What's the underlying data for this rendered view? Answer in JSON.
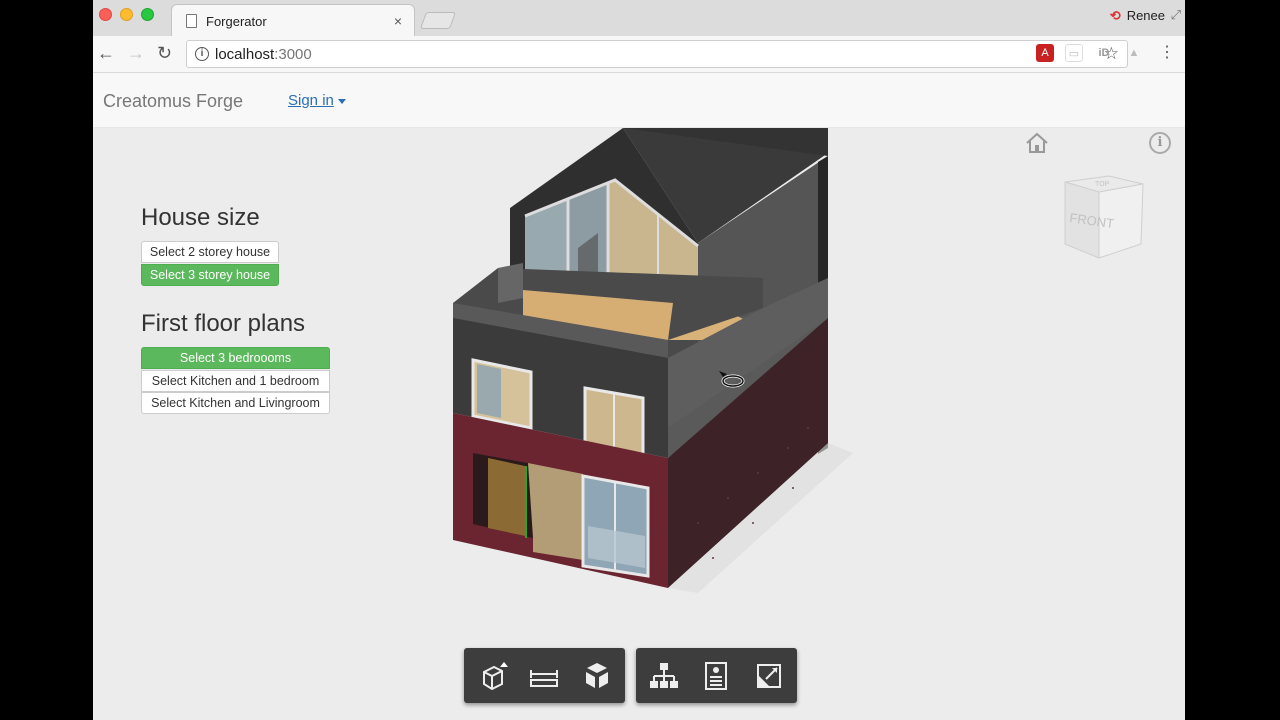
{
  "browser": {
    "tab_title": "Forgerator",
    "tab_close": "×",
    "profile_name": "Renee",
    "url_host": "localhost",
    "url_port": ":3000"
  },
  "app": {
    "brand": "Creatomus Forge",
    "signin": "Sign in"
  },
  "panel": {
    "house_size_title": "House size",
    "house_size_options": [
      "Select 2 storey house",
      "Select 3 storey house"
    ],
    "house_size_selected": 1,
    "plans_title": "First floor plans",
    "plan_options": [
      "Select 3 bedroooms",
      "Select Kitchen and 1 bedroom",
      "Select Kitchen and Livingroom"
    ],
    "plan_selected": 0
  },
  "viewcube": {
    "top_label": "TOP",
    "front_label": "FRONT"
  },
  "toolbar_icons": {
    "group_a": [
      "orbit-icon",
      "measure-icon",
      "explode-icon"
    ],
    "group_b": [
      "model-browser-icon",
      "properties-icon",
      "fullscreen-icon"
    ]
  },
  "colors": {
    "selected_green": "#5cb85c",
    "link_blue": "#2a6fb5",
    "viewer_bg": "#ececec"
  }
}
